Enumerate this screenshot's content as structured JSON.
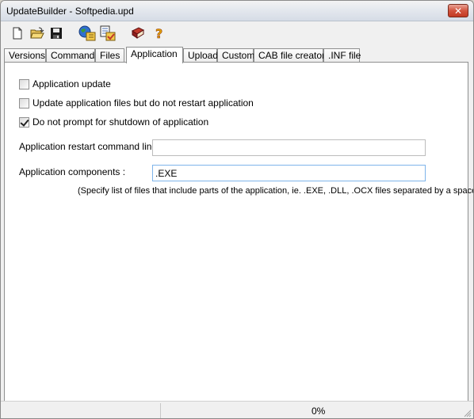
{
  "window": {
    "title": "UpdateBuilder - Softpedia.upd"
  },
  "toolbar": {
    "buttons": [
      {
        "icon": "new-file-icon"
      },
      {
        "icon": "open-folder-icon"
      },
      {
        "icon": "save-icon"
      },
      {
        "icon": "web-update-icon"
      },
      {
        "icon": "build-package-icon"
      },
      {
        "icon": "book-icon"
      },
      {
        "icon": "help-icon"
      }
    ]
  },
  "tabs": [
    "Versions",
    "Commands",
    "Files",
    "Application",
    "Upload",
    "Custom",
    "CAB file creator",
    ".INF file"
  ],
  "active_tab": "Application",
  "options": {
    "app_update": {
      "label": "Application update",
      "checked": false
    },
    "no_restart": {
      "label": "Update application files but do not restart application",
      "checked": false
    },
    "no_prompt": {
      "label": "Do not prompt for shutdown of application",
      "checked": true
    }
  },
  "fields": {
    "restart_cmd": {
      "label": "Application restart command line :",
      "value": ""
    },
    "components": {
      "label": "Application components :",
      "value": ".EXE"
    },
    "components_hint": "(Specify list of files that include parts of the application, ie. .EXE, .DLL, .OCX files separated by a space)"
  },
  "status": {
    "progress": "0%"
  }
}
